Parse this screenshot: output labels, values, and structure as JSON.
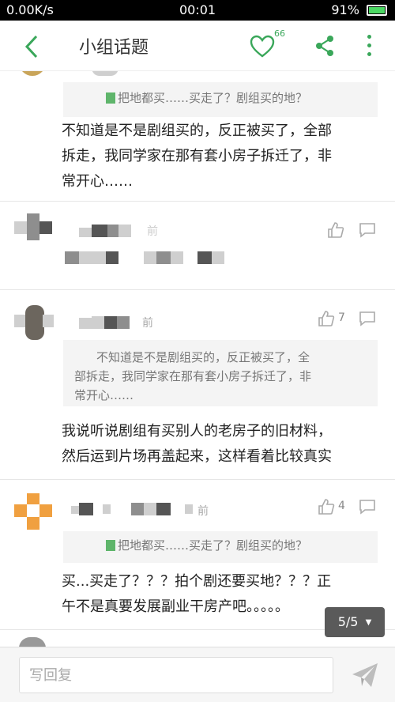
{
  "status": {
    "network": "0.00K/s",
    "time": "00:01",
    "battery": "91%"
  },
  "header": {
    "title": "小组话题",
    "like_count": "66"
  },
  "replies": [
    {
      "quote": "把地都买……买走了？剧组买的地？",
      "text": [
        "不知道是不是剧组买的，反正被买了，全部",
        "拆走，我同学家在那有套小房子拆迁了，非",
        "常开心……"
      ]
    },
    {
      "time": "前"
    },
    {
      "time": "前",
      "like_count": "7",
      "quote": [
        "不知道是不是剧组买的，反正被买了，全",
        "部拆走，我同学家在那有套小房子拆迁了，非",
        "常开心……"
      ],
      "text": [
        "我说听说剧组有买别人的老房子的旧材料，",
        "然后运到片场再盖起来，这样看着比较真实"
      ]
    },
    {
      "time": "前",
      "like_count": "4",
      "quote": "把地都买……买走了？剧组买的地？",
      "text": [
        "买...买走了？？？拍个剧还要买地？？？正",
        "午不是真要发展副业干房产吧。。。。。"
      ]
    }
  ],
  "pager": {
    "label": "5/5",
    "arrow": "▼"
  },
  "composer": {
    "placeholder": "写回复"
  },
  "colors": {
    "accent": "#3aa75a",
    "quote_icon": "#5fb56b"
  }
}
